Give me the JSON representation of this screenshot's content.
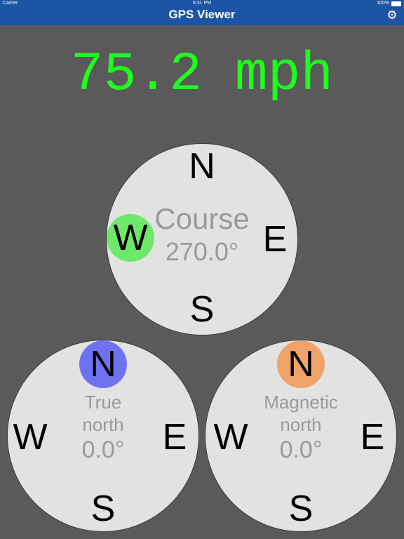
{
  "status_bar": {
    "carrier": "Carrier",
    "time": "6:31 PM",
    "battery": "100%"
  },
  "nav_bar": {
    "title": "GPS Viewer",
    "settings_icon": "gear-icon"
  },
  "speed": {
    "text": "75.2 mph",
    "color": "#1eff1e"
  },
  "course_compass": {
    "label": "Course",
    "value": "270.0°",
    "n": "N",
    "e": "E",
    "s": "S",
    "w": "W",
    "marker_color": "#6de86a"
  },
  "true_north_compass": {
    "label_line1": "True",
    "label_line2": "north",
    "value": "0.0°",
    "n": "N",
    "e": "E",
    "s": "S",
    "w": "W",
    "marker_color": "#6e72ef"
  },
  "magnetic_north_compass": {
    "label_line1": "Magnetic",
    "label_line2": "north",
    "value": "0.0°",
    "n": "N",
    "e": "E",
    "s": "S",
    "w": "W",
    "marker_color": "#efa36a"
  }
}
